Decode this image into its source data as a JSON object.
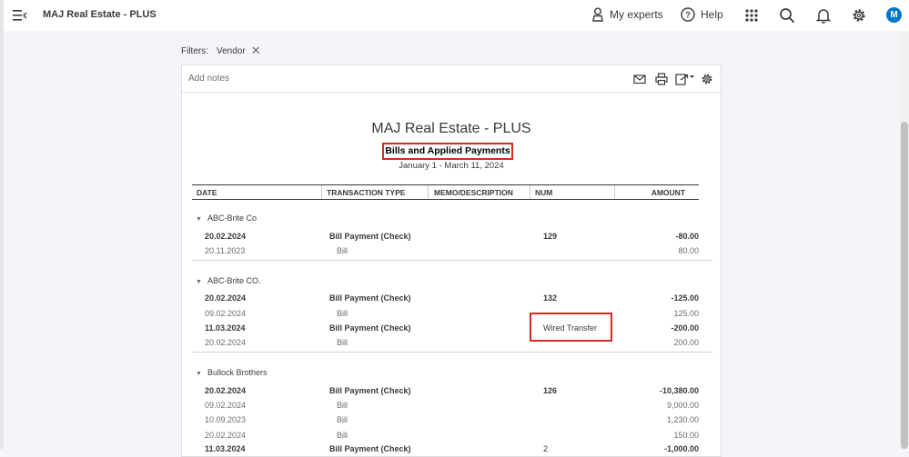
{
  "header": {
    "app_title": "MAJ Real Estate - PLUS",
    "my_experts_label": "My experts",
    "help_label": "Help",
    "avatar_initial": "M"
  },
  "filters": {
    "label": "Filters:",
    "chip_label": "Vendor"
  },
  "report": {
    "notes_placeholder": "Add notes",
    "company": "MAJ Real Estate - PLUS",
    "name": "Bills and Applied Payments",
    "period": "January 1 - March 11, 2024",
    "columns": [
      "DATE",
      "TRANSACTION TYPE",
      "MEMO/DESCRIPTION",
      "NUM",
      "AMOUNT"
    ],
    "groups": [
      {
        "vendor": "ABC-Brite Co",
        "rows": [
          {
            "date": "20.02.2024",
            "type": "Bill Payment (Check)",
            "num": "129",
            "amount": "-80.00"
          },
          {
            "date": "20.11.2023",
            "type": "Bill",
            "num": "",
            "amount": "80.00"
          }
        ]
      },
      {
        "vendor": "ABC-Brite CO.",
        "rows": [
          {
            "date": "20.02.2024",
            "type": "Bill Payment (Check)",
            "num": "132",
            "amount": "-125.00"
          },
          {
            "date": "09.02.2024",
            "type": "Bill",
            "num": "",
            "amount": "125.00"
          },
          {
            "date": "11.03.2024",
            "type": "Bill Payment (Check)",
            "num": "Wired Transfer",
            "amount": "-200.00"
          },
          {
            "date": "20.02.2024",
            "type": "Bill",
            "num": "",
            "amount": "200.00"
          }
        ]
      },
      {
        "vendor": "Bullock Brothers",
        "rows": [
          {
            "date": "20.02.2024",
            "type": "Bill Payment (Check)",
            "num": "126",
            "amount": "-10,380.00"
          },
          {
            "date": "09.02.2024",
            "type": "Bill",
            "num": "",
            "amount": "9,000.00"
          },
          {
            "date": "10.09.2023",
            "type": "Bill",
            "num": "",
            "amount": "1,230.00"
          },
          {
            "date": "20.02.2024",
            "type": "Bill",
            "num": "",
            "amount": "150.00"
          },
          {
            "date": "11.03.2024",
            "type": "Bill Payment (Check)",
            "num": "2",
            "amount": "-1,000.00"
          }
        ]
      }
    ]
  },
  "colors": {
    "highlight_box": "#d52b1e",
    "avatar_bg": "#0077c5"
  }
}
